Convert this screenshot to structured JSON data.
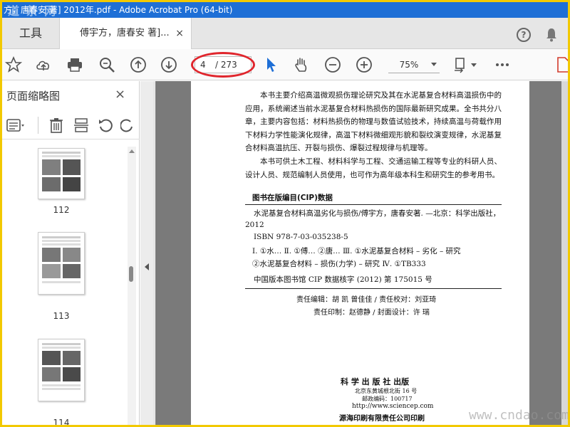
{
  "window": {
    "title": "方，唐春安 著] 2012年.pdf - Adobe Acrobat Pro (64-bit)",
    "watermark_top": "道 茶 网"
  },
  "tabs": {
    "tools_label": "工具",
    "doc_tab_label": "傅宇方，唐春安 著]...",
    "close_glyph": "×"
  },
  "toolbar": {
    "current_page": "4",
    "total_pages": "/ 273",
    "zoom": "75%",
    "accent_color": "#1e6fd6",
    "highlight_color": "#e0262d"
  },
  "sidepanel": {
    "title": "页面缩略图",
    "close_glyph": "×",
    "thumbnails": [
      {
        "label": "112"
      },
      {
        "label": "113"
      },
      {
        "label": "114"
      }
    ]
  },
  "document": {
    "para1": "本书主要介绍高温微观损伤理论研究及其在水泥基复合材料高温损伤中的应用，系统阐述当前水泥基复合材料热损伤的国际最新研究成果。全书共分八章，主要内容包括：材料热损伤的物理与数值试验技术，持续高温与荷载作用下材料力学性能演化规律，高温下材料微细观形貌和裂纹演变规律，水泥基复合材料高温抗压、开裂与损伤、爆裂过程规律与机理等。",
    "para2": "本书可供土木工程、材料科学与工程、交通运输工程等专业的科研人员、设计人员、规范编制人员使用，也可作为高年级本科生和研究生的参考用书。",
    "cip_title": "图书在版编目(CIP)数据",
    "cip_line1": "水泥基复合材料高温劣化与损伤/傅宇方，唐春安著. —北京：科学出版社，",
    "cip_line1b": "2012",
    "cip_isbn": "ISBN 978-7-03-035238-5",
    "cip_class1": "Ⅰ. ①水…  Ⅱ. ①傅…  ②唐…   Ⅲ. ①水泥基复合材料 – 劣化 – 研究",
    "cip_class2": "②水泥基复合材料 – 损伤(力学) – 研究   Ⅳ. ①TB333",
    "cip_number": "中国版本图书馆 CIP 数据核字 (2012) 第 175015 号",
    "editors1": "责任编辑：胡  凯  曾佳佳 / 责任校对：刘亚琦",
    "editors2": "责任印制：赵德静 / 封面设计：许  瑞",
    "publisher": "科 学 出 版 社 出版",
    "address": "北京东黄城根北街 16 号",
    "postcode": "邮政编码：100717",
    "website": "http://www.sciencep.com",
    "printer": "源海印刷有限责任公司印刷"
  },
  "watermark_bottom": "www.cndao.com"
}
